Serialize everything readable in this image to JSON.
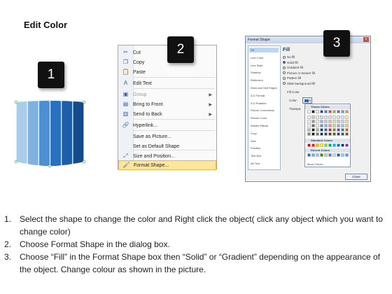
{
  "title": "Edit Color",
  "steps_badges": [
    "1",
    "2",
    "3"
  ],
  "shape_colors": [
    "#a9cce8",
    "#7fb2de",
    "#4d8fd0",
    "#2a70c0",
    "#1c5ea9",
    "#134b8c"
  ],
  "context_menu": {
    "items": [
      {
        "icon": "scissors-icon",
        "glyph": "✂",
        "label": "Cut"
      },
      {
        "icon": "copy-icon",
        "glyph": "❐",
        "label": "Copy"
      },
      {
        "icon": "paste-icon",
        "glyph": "📋",
        "label": "Paste"
      },
      {
        "icon": "edit-text-icon",
        "glyph": "A",
        "label": "Edit Text"
      },
      {
        "icon": "group-icon",
        "glyph": "▣",
        "label": "Group",
        "disabled": true,
        "submenu": true
      },
      {
        "icon": "bring-front-icon",
        "glyph": "▤",
        "label": "Bring to Front",
        "submenu": true
      },
      {
        "icon": "send-back-icon",
        "glyph": "▥",
        "label": "Send to Back",
        "submenu": true
      },
      {
        "icon": "hyperlink-icon",
        "glyph": "🔗",
        "label": "Hyperlink..."
      },
      {
        "icon": "",
        "glyph": "",
        "label": "Save as Picture..."
      },
      {
        "icon": "",
        "glyph": "",
        "label": "Set as Default Shape"
      },
      {
        "icon": "size-position-icon",
        "glyph": "⤢",
        "label": "Size and Position..."
      },
      {
        "icon": "format-shape-icon",
        "glyph": "🖌",
        "label": "Format Shape...",
        "highlighted": true
      }
    ]
  },
  "format_dialog": {
    "title": "Format Shape",
    "close_symbol": "x",
    "categories": [
      "Fill",
      "Line Color",
      "Line Style",
      "Shadow",
      "Reflection",
      "Glow and Soft Edges",
      "3-D Format",
      "3-D Rotation",
      "Picture Corrections",
      "Picture Color",
      "Artistic Effects",
      "Crop",
      "Size",
      "Position",
      "Text Box",
      "Alt Text"
    ],
    "selected_category": "Fill",
    "fill_heading": "Fill",
    "fill_options": [
      {
        "label": "No fill",
        "checked": false
      },
      {
        "label": "Solid fill",
        "checked": true
      },
      {
        "label": "Gradient fill",
        "checked": false
      },
      {
        "label": "Picture or texture fill",
        "checked": false
      },
      {
        "label": "Pattern fill",
        "checked": false
      },
      {
        "label": "Slide background fill",
        "checked": false
      }
    ],
    "fill_color_label": "Fill Color",
    "color_label": "Color:",
    "transparency_label": "Transpa",
    "theme_colors_label": "Theme Colors",
    "standard_colors_label": "Standard Colors",
    "recent_colors_label": "Recent Colors",
    "more_colors_label": "More Colors...",
    "close_label": "Close",
    "theme_row": [
      "#ffffff",
      "#000000",
      "#eeece1",
      "#1f497d",
      "#4f81bd",
      "#c0504d",
      "#9bbb59",
      "#8064a2",
      "#4bacc6",
      "#f79646"
    ],
    "standard_row": [
      "#c00000",
      "#ff0000",
      "#ffc000",
      "#ffff00",
      "#92d050",
      "#00b050",
      "#00b0f0",
      "#0070c0",
      "#002060",
      "#7030a0"
    ],
    "recent_row": [
      "#2c63b3",
      "#6fa8dc",
      "#9fc5e8",
      "#38761d",
      "#b6d7a8",
      "#3d85c6",
      "#cfe2f3",
      "#0b5394",
      "#a4c2f4",
      "#5b9bd5"
    ]
  },
  "instructions": [
    {
      "num": "1.",
      "text": "Select the shape to change the color and Right click the object( click any object which you want to change color)"
    },
    {
      "num": "2.",
      "text": "Choose Format Shape in the dialog box."
    },
    {
      "num": "3.",
      "text": "Choose “Fill” in the Format Shape box then “Solid” or “Gradient” depending on the appearance of the object. Change colour as shown in the picture."
    }
  ]
}
